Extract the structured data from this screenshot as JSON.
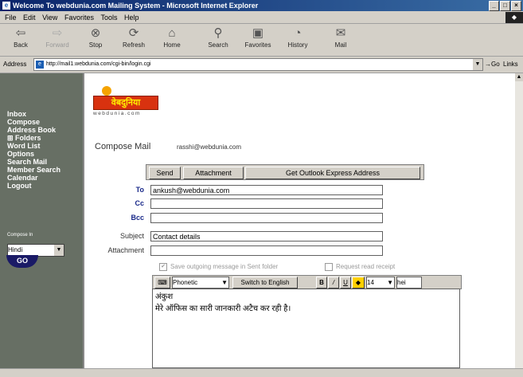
{
  "window": {
    "title": "Welcome To webdunia.com Mailing System - Microsoft Internet Explorer"
  },
  "menu": [
    "File",
    "Edit",
    "View",
    "Favorites",
    "Tools",
    "Help"
  ],
  "toolbar": [
    {
      "label": "Back",
      "icon": "back-arrow-icon",
      "disabled": false
    },
    {
      "label": "Forward",
      "icon": "forward-arrow-icon",
      "disabled": true
    },
    {
      "label": "Stop",
      "icon": "stop-icon",
      "disabled": false
    },
    {
      "label": "Refresh",
      "icon": "refresh-icon",
      "disabled": false
    },
    {
      "label": "Home",
      "icon": "home-icon",
      "disabled": false
    },
    {
      "label": "Search",
      "icon": "search-icon",
      "disabled": false
    },
    {
      "label": "Favorites",
      "icon": "favorites-icon",
      "disabled": false
    },
    {
      "label": "History",
      "icon": "history-icon",
      "disabled": false
    },
    {
      "label": "Mail",
      "icon": "mail-icon",
      "disabled": false
    }
  ],
  "address": {
    "label": "Address",
    "url": "http://mail1.webdunia.com/cgi-bin/login.cgi",
    "go": "Go",
    "links": "Links"
  },
  "sidebar": {
    "items": [
      "Inbox",
      "Compose",
      "Address Book",
      "Folders",
      "Word List",
      "Options",
      "Search Mail",
      "Member Search",
      "Calendar",
      "Logout"
    ],
    "compose_in_label": "Compose In",
    "language": "Hindi",
    "go_label": "GO"
  },
  "logo": {
    "text": "वेबदुनिया",
    "site": "webdunia.com"
  },
  "compose": {
    "title": "Compose Mail",
    "user": "rasshi@webdunia.com",
    "buttons": {
      "send": "Send",
      "attachment": "Attachment",
      "outlook": "Get Outlook Express Address"
    },
    "labels": {
      "to": "To",
      "cc": "Cc",
      "bcc": "Bcc",
      "subject": "Subject",
      "attachment": "Attachment"
    },
    "values": {
      "to": "ankush@webdunia.com",
      "cc": "",
      "bcc": "",
      "subject": "Contact details",
      "attachment": ""
    },
    "save_sent": {
      "label": "Save outgoing message in Sent folder",
      "checked": true
    },
    "read_receipt": {
      "label": "Request read receipt",
      "checked": false
    }
  },
  "editor": {
    "keyboard": "Phonetic",
    "switch_label": "Switch to English",
    "font_size": "14",
    "font_name": "hei",
    "line1": "अंकुश",
    "line2": "मेरे ऑफिस का सारी जानकारी अटैच कर रही है।"
  },
  "colors": {
    "sidebar_bg": "#676f64",
    "titlebar": "#0a246a",
    "logo_red": "#d8320f",
    "logo_yellow": "#ffee00"
  }
}
